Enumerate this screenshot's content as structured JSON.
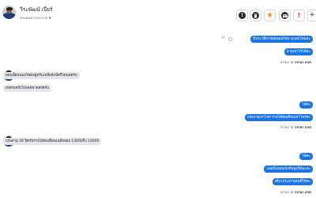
{
  "header": {
    "contact_name": "วีระพัฒน์ เปี่ยร์",
    "status": "ค่าแผนทางประกาศ"
  },
  "actions": [
    {
      "name": "info-button",
      "icon": "info-icon",
      "glyph": "!"
    },
    {
      "name": "delete-button",
      "icon": "trash-icon",
      "glyph": "🗑"
    },
    {
      "name": "star-button",
      "icon": "star-icon",
      "glyph": "★"
    },
    {
      "name": "email-button",
      "icon": "envelope-icon",
      "glyph": "✉"
    },
    {
      "name": "alert-button",
      "icon": "alert-icon",
      "glyph": "!"
    },
    {
      "name": "add-button",
      "icon": "plus-icon",
      "glyph": "+"
    }
  ],
  "messages": [
    {
      "dir": "out",
      "text": "มีประวัติการผ่อนมอไซบางบอกไหมคะ"
    },
    {
      "dir": "out",
      "text": "อายุเท่าไรได้คะ"
    },
    {
      "dir": "in",
      "text": "ตอนนี้ผ่อนมอไซต่อยู่ครับเหลือลีกปีครึ่งหมดครับ"
    },
    {
      "dir": "in",
      "text": "ส่งตรงครับไม่เคยขาดส่งครับ"
    },
    {
      "dir": "out",
      "text": "ได้ค่ะ"
    },
    {
      "dir": "out",
      "text": "แจ้งอายุเท่าไหร่ รายได้ต่อเดือนเท่าไหร่คะ"
    },
    {
      "dir": "in",
      "text": "แจ้งอายุ 28 ปีครับรายได้ต่อเดือนเฉลี่ยจผล 13000ถึง 14000"
    },
    {
      "dir": "out",
      "text": "ได้ค่ะ"
    },
    {
      "dir": "out",
      "text": "แอดมินขอแจ้งข้อมูลให้นะคะ"
    },
    {
      "dir": "out",
      "text": "เดี๋ยวประสานทนที่ให้ค่ะ"
    }
  ],
  "meta": [
    {
      "prefix": "ส่งโดย 🛡",
      "agent": "กรกนก เกษร"
    },
    {
      "prefix": "ส่งโดย 🛡",
      "agent": "กรกนก เกษร"
    },
    {
      "prefix": "ส่งโดย 🛡",
      "agent": "กรกนก เกษร"
    }
  ],
  "colors": {
    "outgoing_bubble": "#1b74e4",
    "incoming_bubble": "#e4e6eb",
    "star": "#f28c28",
    "alert": "#e33a3a"
  }
}
